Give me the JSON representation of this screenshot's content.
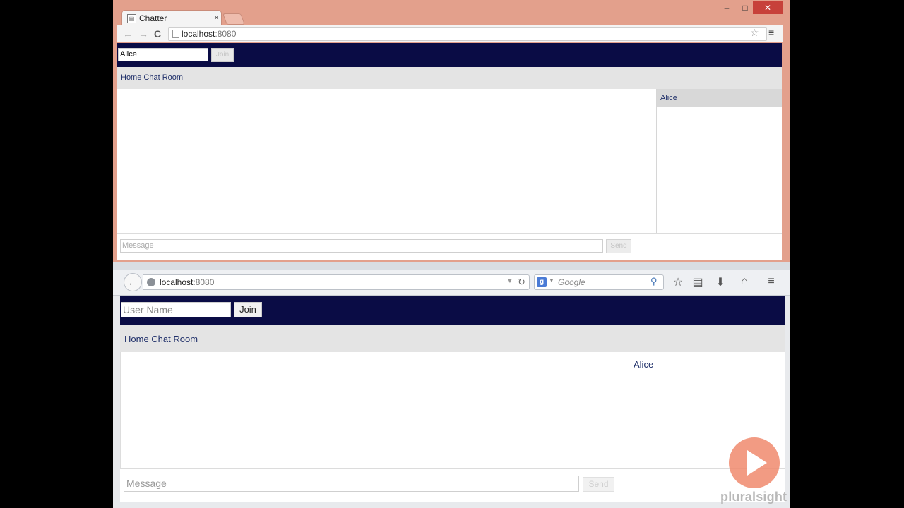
{
  "chrome_window": {
    "tab": {
      "favicon": "page-icon",
      "title": "Chatter",
      "close": "×"
    },
    "window_controls": {
      "minimize": "–",
      "maximize": "□",
      "close": "✕"
    },
    "nav": {
      "back": "←",
      "forward": "→",
      "reload": "C"
    },
    "address": {
      "host": "localhost",
      "port": ":8080"
    },
    "icons": {
      "star": "☆",
      "menu": "≡"
    },
    "app": {
      "username_value": "Alice",
      "join_label": "Join",
      "room_title": "Home Chat Room",
      "users": [
        "Alice"
      ],
      "message_placeholder": "Message",
      "send_label": "Send"
    }
  },
  "firefox_window": {
    "nav": {
      "back": "←",
      "reload": "↻",
      "dropdown": "▼"
    },
    "address": {
      "host": "localhost",
      "port": ":8080"
    },
    "search": {
      "engine_icon": "g",
      "placeholder": "Google",
      "magnifier": "⚲"
    },
    "toolbar_icons": {
      "bookmark": "☆",
      "reading": "▤",
      "download": "⬇",
      "home": "⌂",
      "menu": "≡"
    },
    "app": {
      "username_placeholder": "User Name",
      "join_label": "Join",
      "room_title": "Home Chat Room",
      "users": [
        "Alice"
      ],
      "message_placeholder": "Message",
      "send_label": "Send"
    }
  },
  "watermark": {
    "brand": "pluralsight"
  },
  "colors": {
    "header_navy": "#0a0c45",
    "room_bar": "#e4e4e4",
    "chrome_frame": "#e3a08c",
    "watermark": "#f08a6d"
  }
}
